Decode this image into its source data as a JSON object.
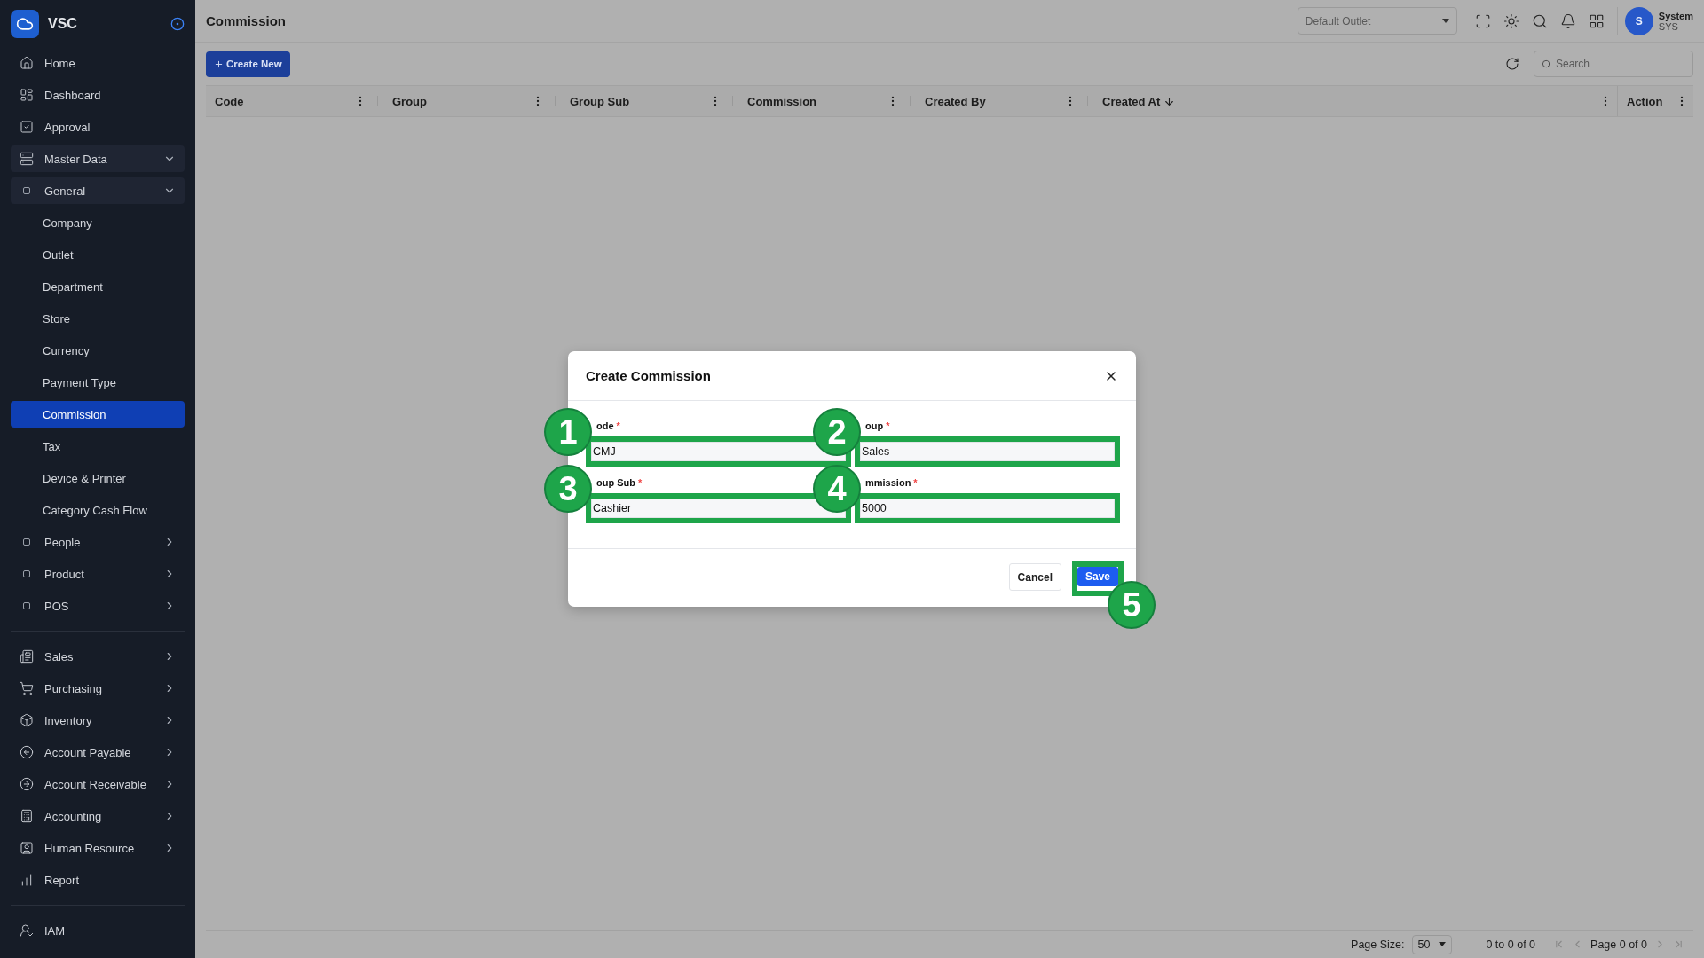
{
  "brand": {
    "name": "VSC"
  },
  "sidebar": {
    "sections": [
      {
        "items": [
          {
            "label": "Home",
            "selected": false
          },
          {
            "label": "Dashboard",
            "selected": false
          },
          {
            "label": "Approval",
            "selected": false
          },
          {
            "label": "Master Data",
            "selected": false,
            "expanded": true,
            "children": [
              {
                "label": "General",
                "selected": false,
                "expanded": true,
                "children": [
                  {
                    "label": "Company",
                    "selected": false
                  },
                  {
                    "label": "Outlet",
                    "selected": false
                  },
                  {
                    "label": "Department",
                    "selected": false
                  },
                  {
                    "label": "Store",
                    "selected": false
                  },
                  {
                    "label": "Currency",
                    "selected": false
                  },
                  {
                    "label": "Payment Type",
                    "selected": false
                  },
                  {
                    "label": "Commission",
                    "selected": true
                  },
                  {
                    "label": "Tax",
                    "selected": false
                  },
                  {
                    "label": "Device & Printer",
                    "selected": false
                  },
                  {
                    "label": "Category Cash Flow",
                    "selected": false
                  }
                ]
              },
              {
                "label": "People",
                "selected": false,
                "expanded": false
              },
              {
                "label": "Product",
                "selected": false,
                "expanded": false
              },
              {
                "label": "POS",
                "selected": false,
                "expanded": false
              }
            ]
          }
        ]
      },
      {
        "items": [
          {
            "label": "Sales",
            "selected": false,
            "expanded": false
          },
          {
            "label": "Purchasing",
            "selected": false,
            "expanded": false
          },
          {
            "label": "Inventory",
            "selected": false,
            "expanded": false
          },
          {
            "label": "Account Payable",
            "selected": false,
            "expanded": false
          },
          {
            "label": "Account Receivable",
            "selected": false,
            "expanded": false
          },
          {
            "label": "Accounting",
            "selected": false,
            "expanded": false
          },
          {
            "label": "Human Resource",
            "selected": false,
            "expanded": false
          },
          {
            "label": "Report",
            "selected": false
          }
        ]
      },
      {
        "items": [
          {
            "label": "IAM",
            "selected": false
          }
        ]
      }
    ]
  },
  "header": {
    "title": "Commission",
    "outlet": {
      "placeholder": "Default Outlet"
    },
    "user": {
      "initial": "S",
      "name": "System",
      "code": "SYS"
    }
  },
  "toolbar": {
    "create_button": "Create New",
    "search": {
      "placeholder": "Search"
    }
  },
  "table": {
    "columns": [
      {
        "label": "Code",
        "sorted": false
      },
      {
        "label": "Group",
        "sorted": false
      },
      {
        "label": "Group Sub",
        "sorted": false
      },
      {
        "label": "Commission",
        "sorted": false
      },
      {
        "label": "Created By",
        "sorted": false
      },
      {
        "label": "Created At",
        "sorted": true
      },
      {
        "label": "Action",
        "sorted": false
      }
    ]
  },
  "pagination": {
    "page_size_label": "Page Size:",
    "page_size": "50",
    "range": "0 to 0 of 0",
    "page": "Page 0 of 0"
  },
  "dialog": {
    "title": "Create Commission",
    "fields": [
      {
        "label": "ode",
        "required_mark": "*",
        "value": "CMJ",
        "marker": "1"
      },
      {
        "label": "oup",
        "required_mark": "*",
        "value": "Sales",
        "marker": "2"
      },
      {
        "label": "oup Sub",
        "required_mark": "*",
        "value": "Cashier",
        "marker": "3"
      },
      {
        "label": "mmission",
        "required_mark": "*",
        "value": "5000",
        "marker": "4"
      }
    ],
    "buttons": [
      {
        "label": "Cancel",
        "kind": "secondary"
      },
      {
        "label": "Save",
        "kind": "primary",
        "marker": "5"
      }
    ]
  }
}
